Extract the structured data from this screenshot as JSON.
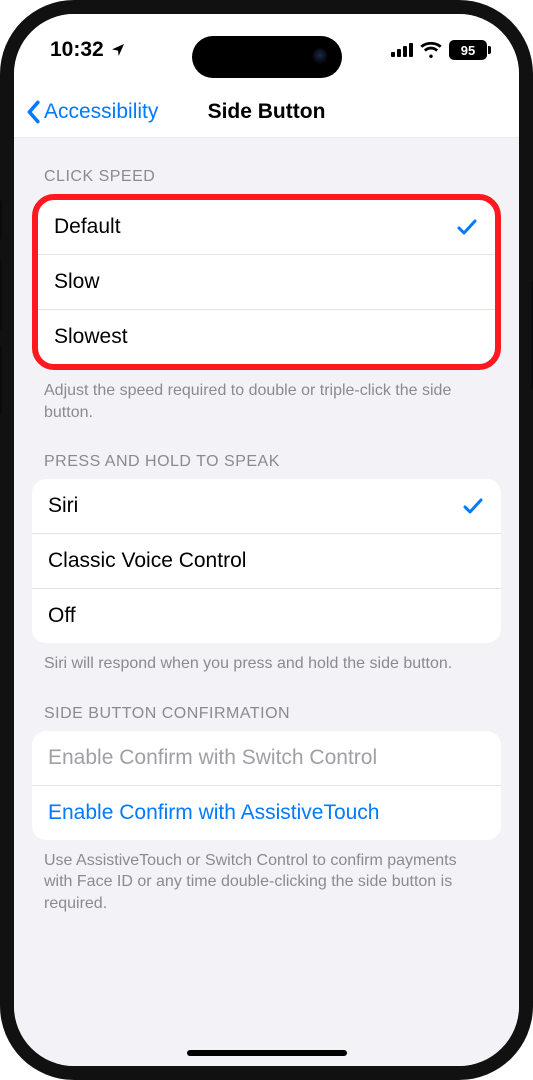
{
  "status": {
    "time": "10:32",
    "battery": "95"
  },
  "nav": {
    "back_label": "Accessibility",
    "title": "Side Button"
  },
  "sections": {
    "click_speed": {
      "header": "CLICK SPEED",
      "items": [
        {
          "label": "Default",
          "checked": true
        },
        {
          "label": "Slow",
          "checked": false
        },
        {
          "label": "Slowest",
          "checked": false
        }
      ],
      "footer": "Adjust the speed required to double or triple-click the side button."
    },
    "press_hold": {
      "header": "PRESS AND HOLD TO SPEAK",
      "items": [
        {
          "label": "Siri",
          "checked": true
        },
        {
          "label": "Classic Voice Control",
          "checked": false
        },
        {
          "label": "Off",
          "checked": false
        }
      ],
      "footer": "Siri will respond when you press and hold the side button."
    },
    "confirm": {
      "header": "SIDE BUTTON CONFIRMATION",
      "items": [
        {
          "label": "Enable Confirm with Switch Control",
          "style": "disabled"
        },
        {
          "label": "Enable Confirm with AssistiveTouch",
          "style": "link"
        }
      ],
      "footer": "Use AssistiveTouch or Switch Control to confirm payments with Face ID or any time double-clicking the side button is required."
    }
  }
}
